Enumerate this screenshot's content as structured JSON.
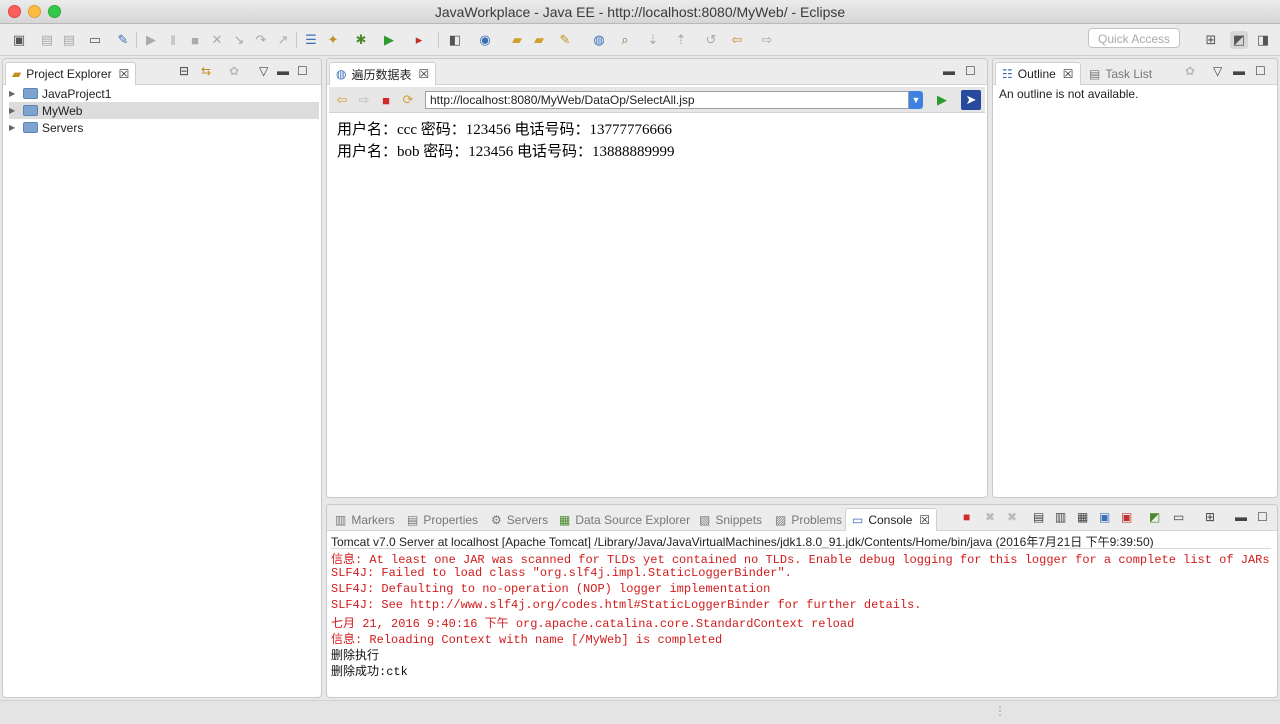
{
  "window": {
    "title": "JavaWorkplace - Java EE - http://localhost:8080/MyWeb/ - Eclipse"
  },
  "toolbar": {
    "quick_access_placeholder": "Quick Access"
  },
  "project_explorer": {
    "tab_label": "Project Explorer",
    "items": [
      {
        "label": "JavaProject1"
      },
      {
        "label": "MyWeb"
      },
      {
        "label": "Servers"
      }
    ]
  },
  "editor": {
    "tab_label": "遍历数据表",
    "url": "http://localhost:8080/MyWeb/DataOp/SelectAll.jsp",
    "lines": [
      "用户名：ccc 密码：123456 电话号码：13777776666",
      "用户名：bob 密码：123456 电话号码：13888889999"
    ]
  },
  "outline": {
    "tab_label": "Outline",
    "task_list_label": "Task List",
    "message": "An outline is not available."
  },
  "console_panel": {
    "tabs": [
      "Markers",
      "Properties",
      "Servers",
      "Data Source Explorer",
      "Snippets",
      "Problems",
      "Console"
    ],
    "server_line": "Tomcat v7.0 Server at localhost [Apache Tomcat] /Library/Java/JavaVirtualMachines/jdk1.8.0_91.jdk/Contents/Home/bin/java (2016年7月21日 下午9:39:50)",
    "lines": [
      {
        "text": "信息: At least one JAR was scanned for TLDs yet contained no TLDs. Enable debug logging for this logger for a complete list of JARs that"
      },
      {
        "text": "SLF4J: Failed to load class \"org.slf4j.impl.StaticLoggerBinder\"."
      },
      {
        "text": "SLF4J: Defaulting to no-operation (NOP) logger implementation"
      },
      {
        "text": "SLF4J: See http://www.slf4j.org/codes.html#StaticLoggerBinder for further details."
      },
      {
        "text": "七月 21, 2016 9:40:16 下午 org.apache.catalina.core.StandardContext reload"
      },
      {
        "text": "信息: Reloading Context with name [/MyWeb] is completed"
      },
      {
        "text": "删除执行"
      },
      {
        "text": "删除成功:ctk"
      }
    ],
    "colors": {
      "error": "#d21c1c",
      "normal": "#111111"
    }
  }
}
